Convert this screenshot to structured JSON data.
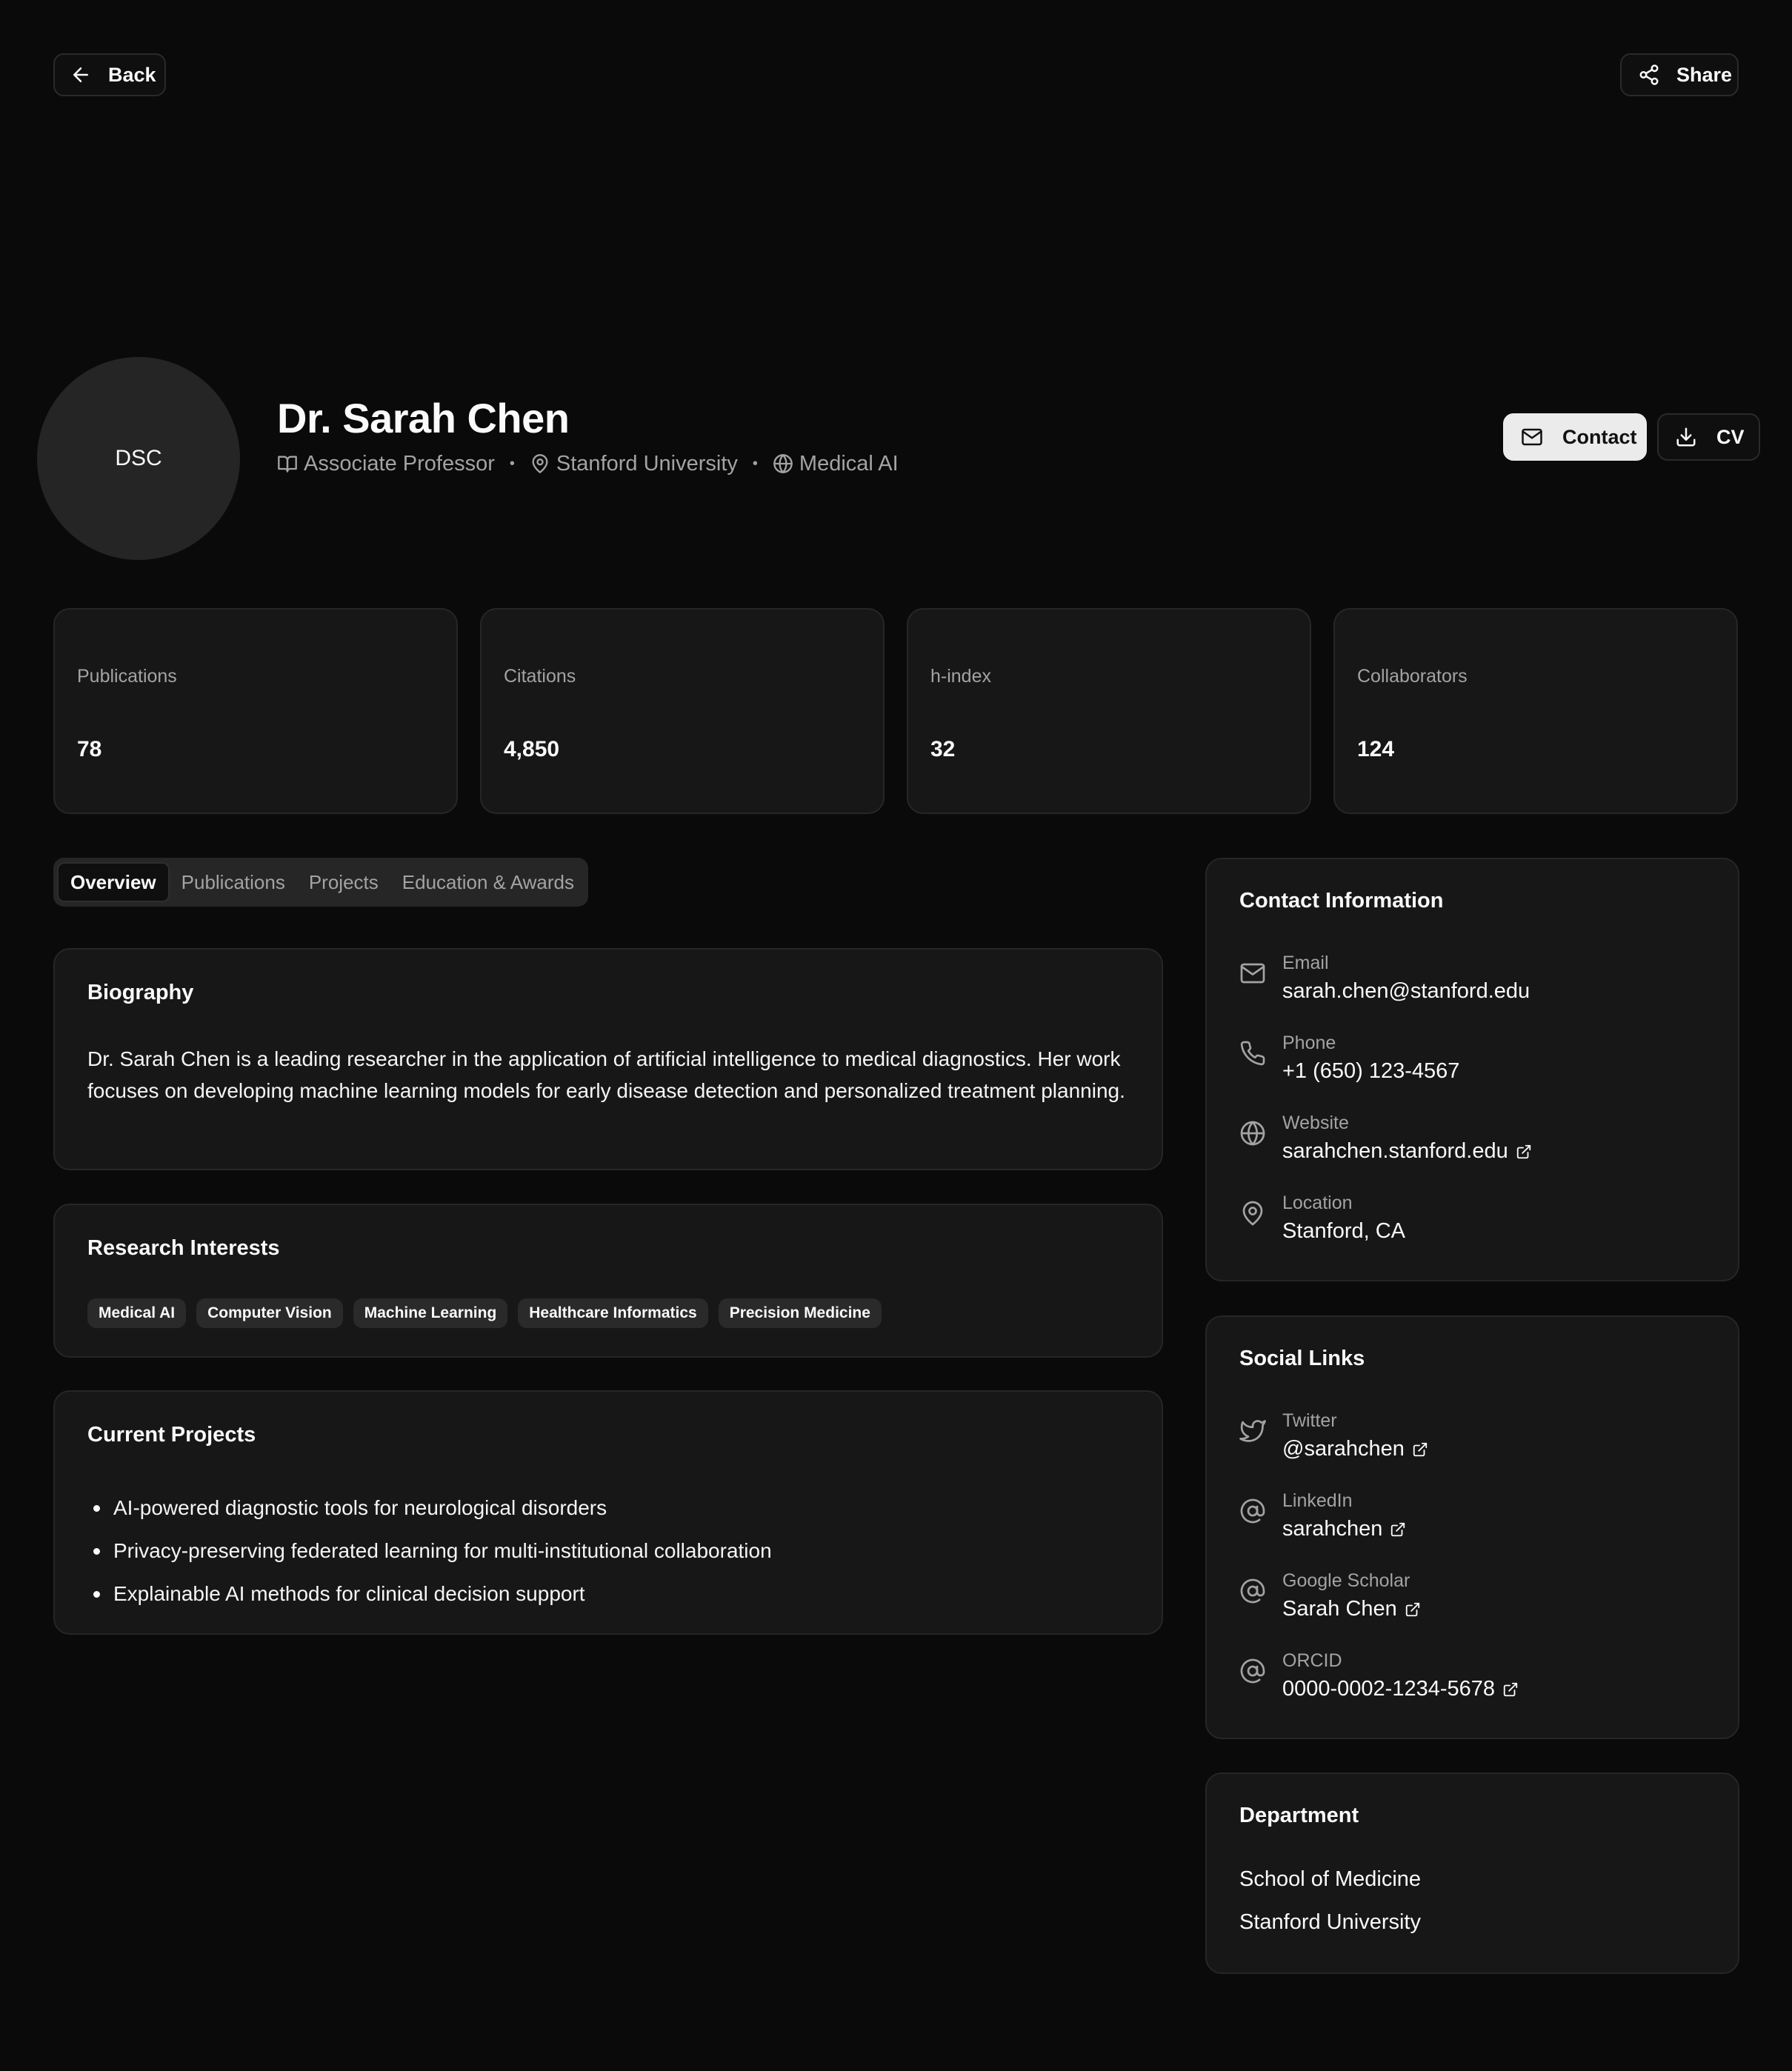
{
  "nav": {
    "back_label": "Back",
    "share_label": "Share"
  },
  "profile": {
    "initials": "DSC",
    "name": "Dr. Sarah Chen",
    "title": "Associate Professor",
    "institution": "Stanford University",
    "field": "Medical AI",
    "separator": "•"
  },
  "actions": {
    "contact_label": "Contact",
    "cv_label": "CV"
  },
  "stats": [
    {
      "label": "Publications",
      "value": "78"
    },
    {
      "label": "Citations",
      "value": "4,850"
    },
    {
      "label": "h-index",
      "value": "32"
    },
    {
      "label": "Collaborators",
      "value": "124"
    }
  ],
  "tabs": [
    {
      "label": "Overview",
      "active": true
    },
    {
      "label": "Publications",
      "active": false
    },
    {
      "label": "Projects",
      "active": false
    },
    {
      "label": "Education & Awards",
      "active": false
    }
  ],
  "biography": {
    "title": "Biography",
    "text": "Dr. Sarah Chen is a leading researcher in the application of artificial intelligence to medical diagnostics. Her work focuses on developing machine learning models for early disease detection and personalized treatment planning."
  },
  "interests": {
    "title": "Research Interests",
    "tags": [
      "Medical AI",
      "Computer Vision",
      "Machine Learning",
      "Healthcare Informatics",
      "Precision Medicine"
    ]
  },
  "projects": {
    "title": "Current Projects",
    "items": [
      "AI-powered diagnostic tools for neurological disorders",
      "Privacy-preserving federated learning for multi-institutional collaboration",
      "Explainable AI methods for clinical decision support"
    ]
  },
  "contact": {
    "title": "Contact Information",
    "items": [
      {
        "label": "Email",
        "value": "sarah.chen@stanford.edu",
        "icon": "mail-icon",
        "external": false
      },
      {
        "label": "Phone",
        "value": "+1 (650) 123-4567",
        "icon": "phone-icon",
        "external": false
      },
      {
        "label": "Website",
        "value": "sarahchen.stanford.edu",
        "icon": "globe-icon",
        "external": true
      },
      {
        "label": "Location",
        "value": "Stanford, CA",
        "icon": "map-pin-icon",
        "external": false
      }
    ]
  },
  "social": {
    "title": "Social Links",
    "items": [
      {
        "label": "Twitter",
        "value": "@sarahchen",
        "icon": "twitter-icon"
      },
      {
        "label": "LinkedIn",
        "value": "sarahchen",
        "icon": "at-sign-icon"
      },
      {
        "label": "Google Scholar",
        "value": "Sarah Chen",
        "icon": "at-sign-icon"
      },
      {
        "label": "ORCID",
        "value": "0000-0002-1234-5678",
        "icon": "at-sign-icon"
      }
    ]
  },
  "department": {
    "title": "Department",
    "lines": [
      "School of Medicine",
      "Stanford University"
    ]
  },
  "colors": {
    "background": "#0a0a0a",
    "card": "#171717",
    "border": "#262626",
    "muted_text": "#a3a3a3",
    "primary_button": "#ebebeb"
  }
}
